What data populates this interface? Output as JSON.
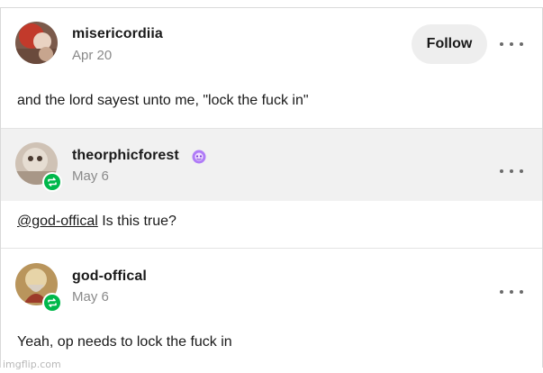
{
  "posts": [
    {
      "username": "misericordiia",
      "date": "Apr 20",
      "text": "and the lord sayest unto me, \"lock the fuck in\"",
      "follow_label": "Follow",
      "avatar_icon": "avatar-image",
      "more_icon": "more-options-icon"
    },
    {
      "username": "theorphicforest",
      "date": "May 6",
      "badge_icon": "creator-badge-icon",
      "reblog_icon": "reblog-icon",
      "mention": "@god-offical",
      "text": " Is this true?",
      "more_icon": "more-options-icon"
    },
    {
      "username": "god-offical",
      "date": "May 6",
      "reblog_icon": "reblog-icon",
      "text": "Yeah, op needs to lock the fuck in",
      "more_icon": "more-options-icon"
    }
  ],
  "watermark": "imgflip.com",
  "colors": {
    "reblog_green": "#00b84b",
    "badge_purple": "#a25cf5",
    "muted_text": "#8a8a8a",
    "header_gray": "#f1f1f1"
  }
}
